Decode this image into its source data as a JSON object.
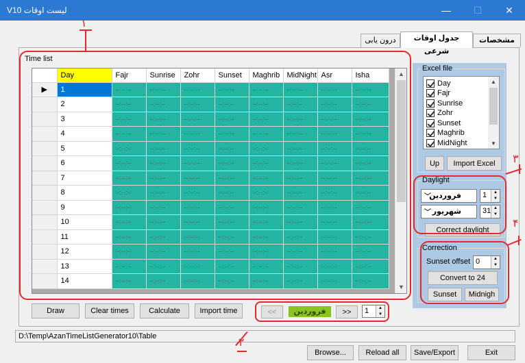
{
  "window": {
    "title": "V10 لیست اوقات",
    "minimize": "—",
    "maximize": "☐",
    "close": "✕"
  },
  "tabs": [
    {
      "label": "مشخصات متد"
    },
    {
      "label": "جدول اوقات شرعی"
    },
    {
      "label": "درون یابی"
    }
  ],
  "grid": {
    "group_label": "Time list",
    "columns": [
      "Day",
      "Fajr",
      "Sunrise",
      "Zohr",
      "Sunset",
      "Maghrib",
      "MidNight",
      "Asr",
      "Isha"
    ],
    "rows": [
      "1",
      "2",
      "3",
      "4",
      "5",
      "6",
      "7",
      "8",
      "9",
      "10",
      "11",
      "12",
      "13",
      "14"
    ],
    "empty_time": "--:--:--",
    "current_row_marker": "▶"
  },
  "bottom_buttons": {
    "draw": "Draw",
    "clear_times": "Clear times",
    "calculate": "Calculate",
    "import_time": "Import time"
  },
  "nav": {
    "prev": "<<",
    "month": "فروردین",
    "next": ">>",
    "page": "1"
  },
  "excel": {
    "legend": "Excel file",
    "items": [
      "Day",
      "Fajr",
      "Sunrise",
      "Zohr",
      "Sunset",
      "Maghrib",
      "MidNight"
    ],
    "up": "Up",
    "import": "Import Excel"
  },
  "daylight": {
    "legend": "Daylight",
    "start_month": "فروردین",
    "start_day": "1",
    "end_month": "شهریور",
    "end_day": "31",
    "correct": "Correct daylight"
  },
  "correction": {
    "legend": "Correction",
    "sunset_offset_label": "Sunset offset",
    "sunset_offset_value": "0",
    "convert": "Convert to 24",
    "sunset": "Sunset",
    "midnight": "Midnigh"
  },
  "path": "D:\\Temp\\AzanTimeListGenerator10\\Table",
  "footer": {
    "browse": "Browse...",
    "reload": "Reload all",
    "save": "Save/Export",
    "exit": "Exit"
  },
  "annotations": {
    "n1": "١",
    "n2": "٢",
    "n3": "٣",
    "n4": "۴"
  },
  "colors": {
    "titlebar": "#2b79d2",
    "time_cell": "#24b4a2",
    "day_header": "#ffff00",
    "selected_day": "#0078d7",
    "right_panel": "#aec9e3",
    "month_badge": "#8ac41e",
    "annotation": "#e8262d"
  }
}
